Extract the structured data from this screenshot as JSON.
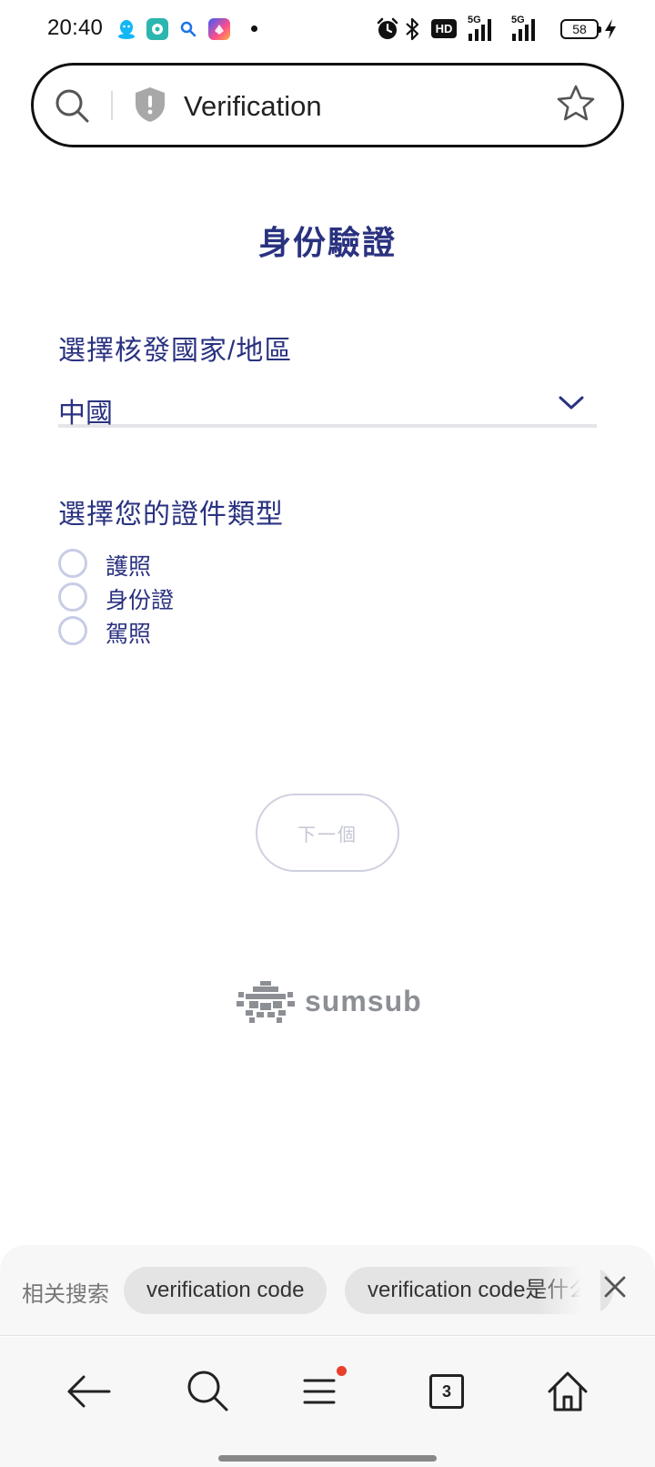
{
  "status_bar": {
    "time": "20:40",
    "network_label_hd": "HD",
    "signal_1_label": "5G",
    "signal_2_label": "5G",
    "battery_level": "58",
    "icons": [
      "qq-icon",
      "messenger-icon",
      "search-app-icon",
      "shortcut-app-icon",
      "notification-dot",
      "alarm-icon",
      "bluetooth-icon",
      "hd-icon",
      "signal-icon",
      "signal-icon",
      "battery-icon",
      "charging-icon"
    ]
  },
  "address_bar": {
    "title": "Verification",
    "icons": [
      "search-icon",
      "shield-icon",
      "star-icon"
    ]
  },
  "page": {
    "title": "身份驗證",
    "country_label": "選擇核發國家/地區",
    "country_value": "中國",
    "document_type_label": "選擇您的證件類型",
    "document_options": [
      {
        "label": "護照",
        "selected": false
      },
      {
        "label": "身份證",
        "selected": false
      },
      {
        "label": "駕照",
        "selected": false
      }
    ],
    "next_button_label": "下一個",
    "next_button_disabled": true,
    "brand_name": "sumsub"
  },
  "related_search": {
    "label": "相关搜索",
    "chips": [
      "verification code",
      "verification code是什么"
    ],
    "icons": [
      "close-icon"
    ]
  },
  "bottom_nav": {
    "tab_count": "3",
    "menu_has_notification": true,
    "icons": [
      "back-arrow-icon",
      "search-icon",
      "menu-icon",
      "tabs-icon",
      "home-icon"
    ]
  },
  "colors": {
    "primary_text": "#2a3280",
    "radio_border": "#c8cde6",
    "notification_dot": "#e8402c",
    "disabled_button_text": "#c4c6d4"
  }
}
